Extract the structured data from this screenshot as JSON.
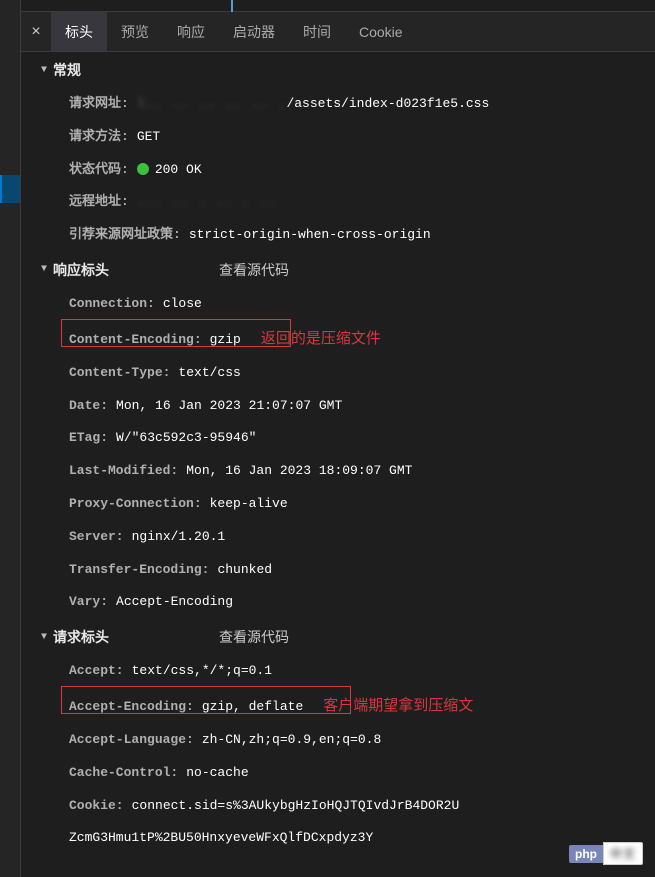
{
  "tabs": {
    "close": "×",
    "items": [
      "标头",
      "预览",
      "响应",
      "启动器",
      "时间",
      "Cookie"
    ],
    "active_index": 0
  },
  "sections": {
    "general": {
      "title": "常规",
      "request_url_label": "请求网址:",
      "request_url_value": "/assets/index-d023f1e5.css",
      "request_method_label": "请求方法:",
      "request_method_value": "GET",
      "status_code_label": "状态代码:",
      "status_code_value": "200 OK",
      "remote_addr_label": "远程地址:",
      "remote_addr_value": "",
      "referrer_policy_label": "引荐来源网址政策:",
      "referrer_policy_value": "strict-origin-when-cross-origin"
    },
    "response": {
      "title": "响应标头",
      "view_source": "查看源代码",
      "rows": [
        {
          "label": "Connection:",
          "value": "close"
        },
        {
          "label": "Content-Encoding:",
          "value": "gzip"
        },
        {
          "label": "Content-Type:",
          "value": "text/css"
        },
        {
          "label": "Date:",
          "value": "Mon, 16 Jan 2023 21:07:07 GMT"
        },
        {
          "label": "ETag:",
          "value": "W/\"63c592c3-95946\""
        },
        {
          "label": "Last-Modified:",
          "value": "Mon, 16 Jan 2023 18:09:07 GMT"
        },
        {
          "label": "Proxy-Connection:",
          "value": "keep-alive"
        },
        {
          "label": "Server:",
          "value": "nginx/1.20.1"
        },
        {
          "label": "Transfer-Encoding:",
          "value": "chunked"
        },
        {
          "label": "Vary:",
          "value": "Accept-Encoding"
        }
      ],
      "annotation": "返回的是压缩文件"
    },
    "request": {
      "title": "请求标头",
      "view_source": "查看源代码",
      "rows": [
        {
          "label": "Accept:",
          "value": "text/css,*/*;q=0.1"
        },
        {
          "label": "Accept-Encoding:",
          "value": "gzip, deflate"
        },
        {
          "label": "Accept-Language:",
          "value": "zh-CN,zh;q=0.9,en;q=0.8"
        },
        {
          "label": "Cache-Control:",
          "value": "no-cache"
        },
        {
          "label": "Cookie:",
          "value": "connect.sid=s%3AUkybgHzIoHQJTQIvdJrB4DOR2U"
        },
        {
          "label": "",
          "value": "ZcmG3Hmu1tP%2BU50HnxyeveWFxQlfDCxpdyz3Y"
        }
      ],
      "annotation": "客户端期望拿到压缩文"
    }
  },
  "footer": {
    "php": "php",
    "cn": "中文"
  }
}
